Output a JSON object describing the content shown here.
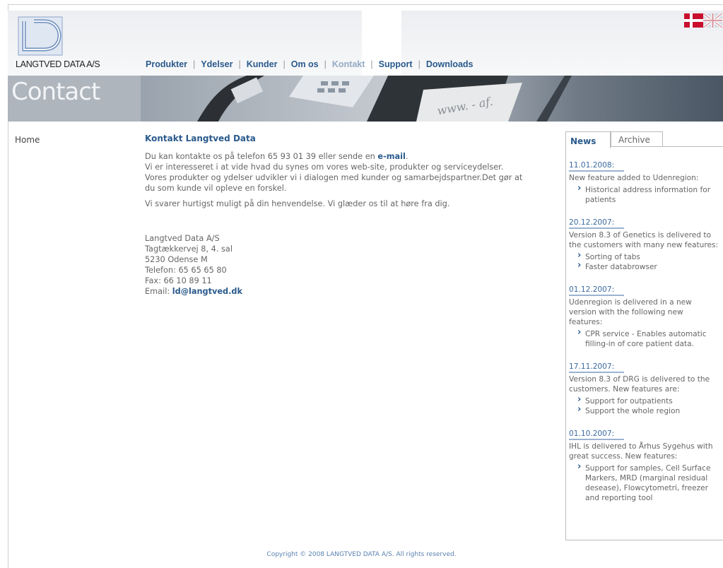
{
  "brand": {
    "name": "LANGTVED DATA A/S",
    "logo_letters": "LD"
  },
  "nav": {
    "items": [
      "Produkter",
      "Ydelser",
      "Kunder",
      "Om os",
      "Kontakt",
      "Support",
      "Downloads"
    ],
    "active": "Kontakt"
  },
  "banner": {
    "title": "Contact",
    "photo_text": "www. - af."
  },
  "sidebar": {
    "home": "Home"
  },
  "main": {
    "heading": "Kontakt Langtved Data",
    "p1_pre": "Du kan kontakte os på telefon 65 93 01 39 eller sende en ",
    "p1_link": "e-mail",
    "p1_post": ".",
    "p1_rest": "Vi er interesseret i at vide hvad du synes om vores web-site, produkter og serviceydelser. Vores produkter og ydelser udvikler vi i dialogen med kunder og samarbejdspartner.Det gør at du som kunde vil opleve en forskel.",
    "p2": "Vi svarer hurtigst muligt på din henvendelse. Vi glæder os til at høre fra dig.",
    "address": {
      "company": "Langtved Data A/S",
      "street": "Tagtækkervej 8, 4. sal",
      "city": "5230 Odense M",
      "phone": "Telefon: 65 65 65 80",
      "fax": "Fax: 66 10 89 11",
      "email_label": "Email: ",
      "email": "ld@langtved.dk"
    }
  },
  "news": {
    "tabs": [
      "News",
      "Archive"
    ],
    "items": [
      {
        "date": "11.01.2008:",
        "text": "New feature added to Udenregion:",
        "bullets": [
          "Historical address information for patients"
        ]
      },
      {
        "date": "20.12.2007:",
        "text": "Version 8.3 of Genetics is delivered to the customers with many new features:",
        "bullets": [
          "Sorting of tabs",
          "Faster databrowser"
        ]
      },
      {
        "date": "01.12.2007:",
        "text": "Udenregion is delivered in a new version with the following new features:",
        "bullets": [
          "CPR service - Enables automatic filling-in of core patient data."
        ]
      },
      {
        "date": "17.11.2007:",
        "text": "Version 8.3 of DRG is delivered to the customers. New features are:",
        "bullets": [
          "Support for outpatients",
          "Support the whole region"
        ]
      },
      {
        "date": "01.10.2007:",
        "text": "IHL is delivered to Århus Sygehus with great success. New features:",
        "bullets": [
          "Support for samples, Cell Surface Markers, MRD (marginal residual desease), Flowcytometri, freezer and reporting tool"
        ]
      }
    ]
  },
  "footer": "Copyright © 2008 LANGTVED DATA A/S. All rights reserved.",
  "colors": {
    "link": "#2a5a8c",
    "active_nav": "#95aac4",
    "banner": "#aeb5bd"
  },
  "icons": {
    "flags": [
      "danish-flag-icon",
      "uk-flag-icon"
    ]
  }
}
